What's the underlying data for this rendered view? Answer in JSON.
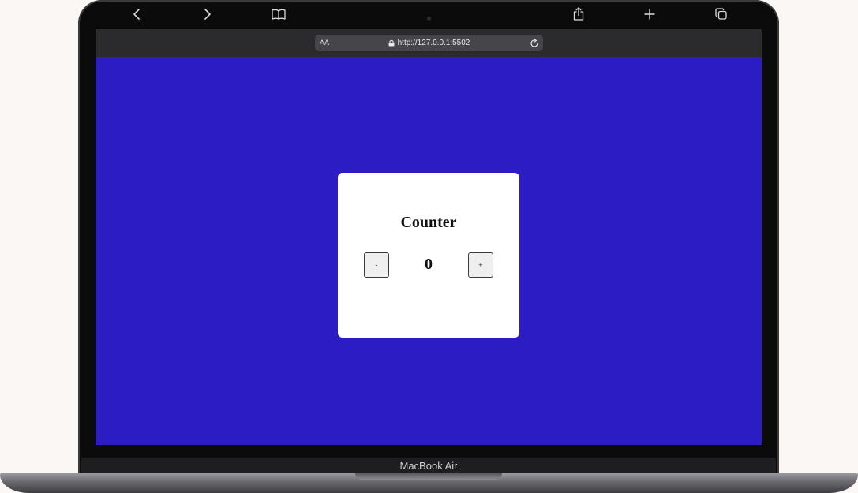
{
  "device": {
    "brand_label": "MacBook Air"
  },
  "browser": {
    "text_size_label": "AA",
    "url": "http://127.0.0.1:5502",
    "icons": {
      "back": "chevron-left-icon",
      "forward": "chevron-right-icon",
      "reader": "book-icon",
      "lock": "lock-icon",
      "reload": "reload-icon",
      "share": "share-icon",
      "new_tab": "plus-icon",
      "tabs": "tabs-icon"
    }
  },
  "page": {
    "background_color": "#2b1dc3",
    "card": {
      "title": "Counter",
      "decrement_label": "-",
      "increment_label": "+",
      "count": "0"
    }
  }
}
